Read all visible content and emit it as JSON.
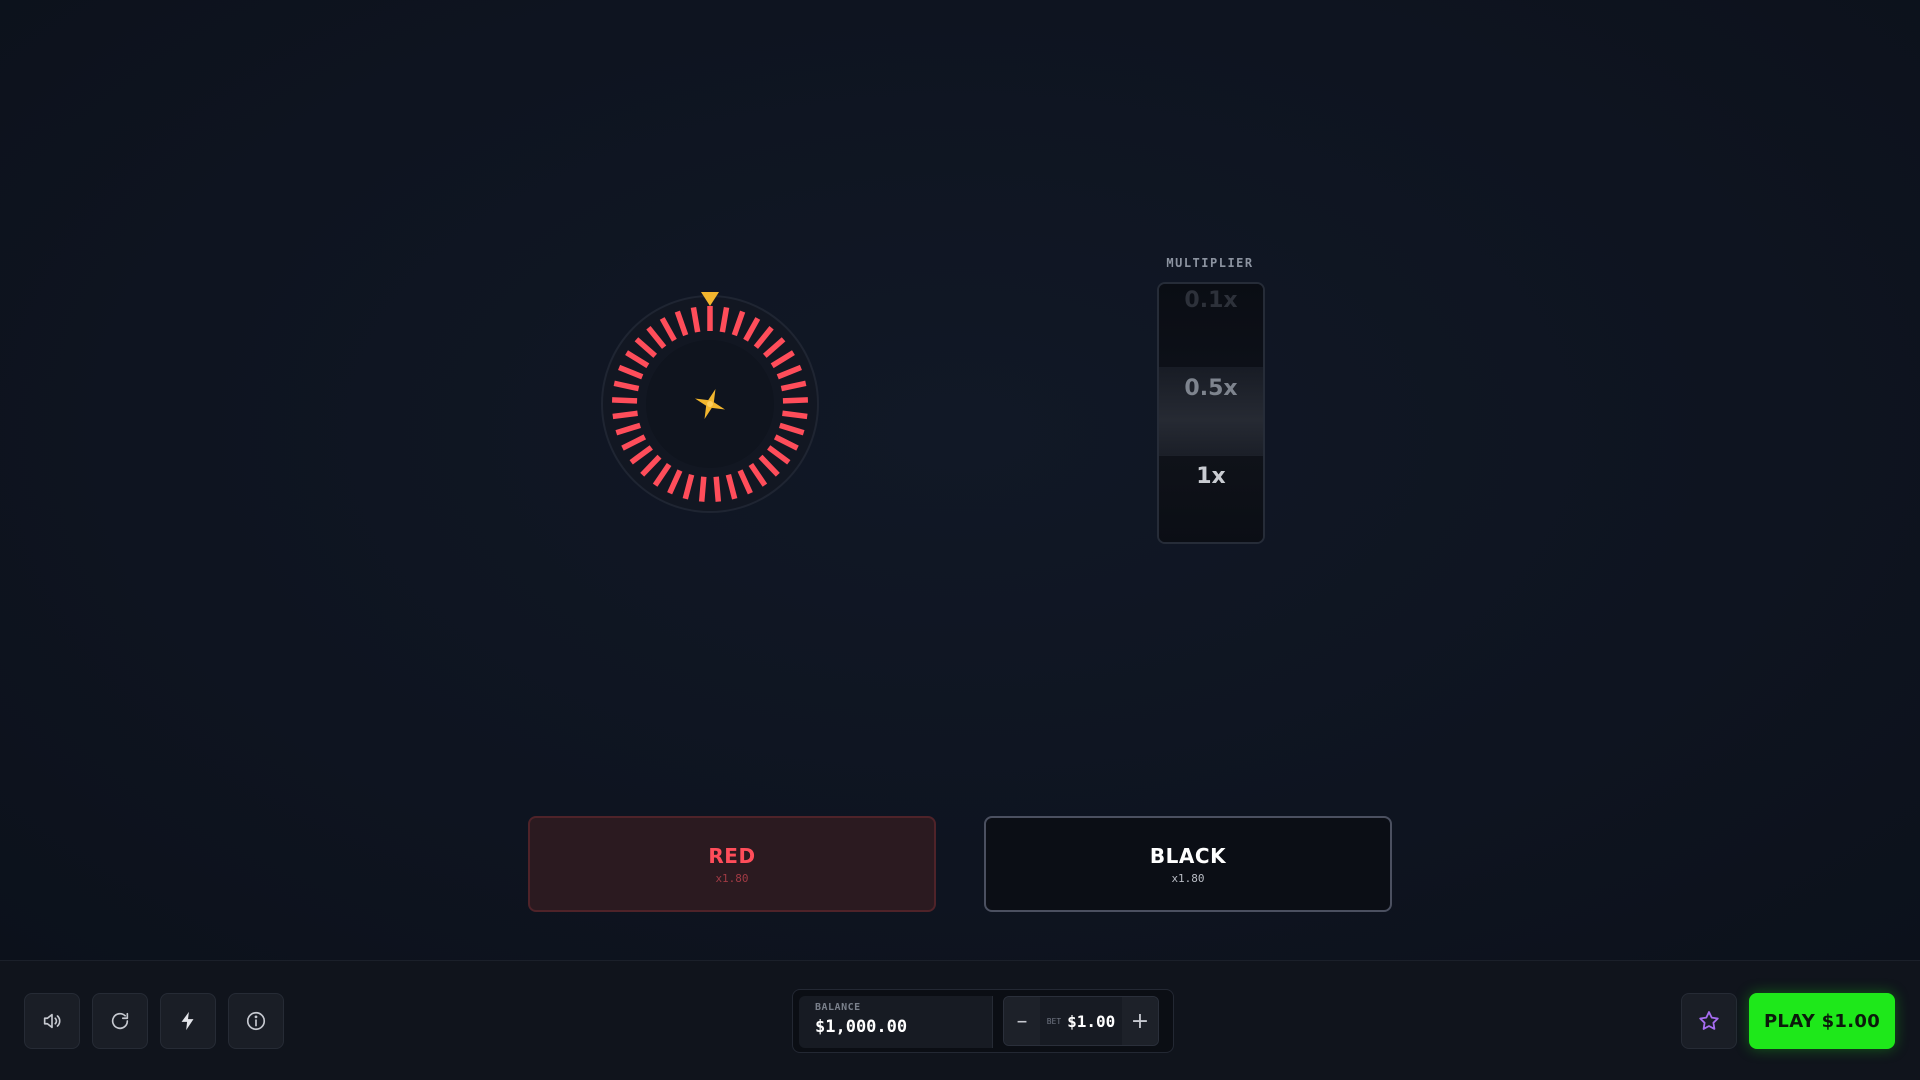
{
  "wheel": {
    "segment_count": 37,
    "segment_color": "#ff4d5a",
    "ring_color": "#121722",
    "center_icon": "spinner-cross-icon",
    "pointer_color": "#f2b62e"
  },
  "multiplier": {
    "label": "MULTIPLIER",
    "values": [
      "0.1x",
      "0.5x",
      "1x"
    ]
  },
  "choices": {
    "red": {
      "label": "RED",
      "odds": "x1.80",
      "color": "#ff4d5a"
    },
    "black": {
      "label": "BLACK",
      "odds": "x1.80",
      "color": "#ffffff"
    }
  },
  "toolbar": {
    "icons": [
      "volume-icon",
      "refresh-icon",
      "lightning-icon",
      "info-icon"
    ]
  },
  "wallet": {
    "balance_label": "BALANCE",
    "balance_value": "$1,000.00",
    "bet_label": "BET",
    "bet_value": "$1.00",
    "minus_label": "–",
    "plus_label": "+"
  },
  "play": {
    "label": "PLAY $1.00",
    "color": "#1ee81a"
  },
  "favorite": {
    "icon": "star-icon",
    "color": "#a66cf0"
  }
}
